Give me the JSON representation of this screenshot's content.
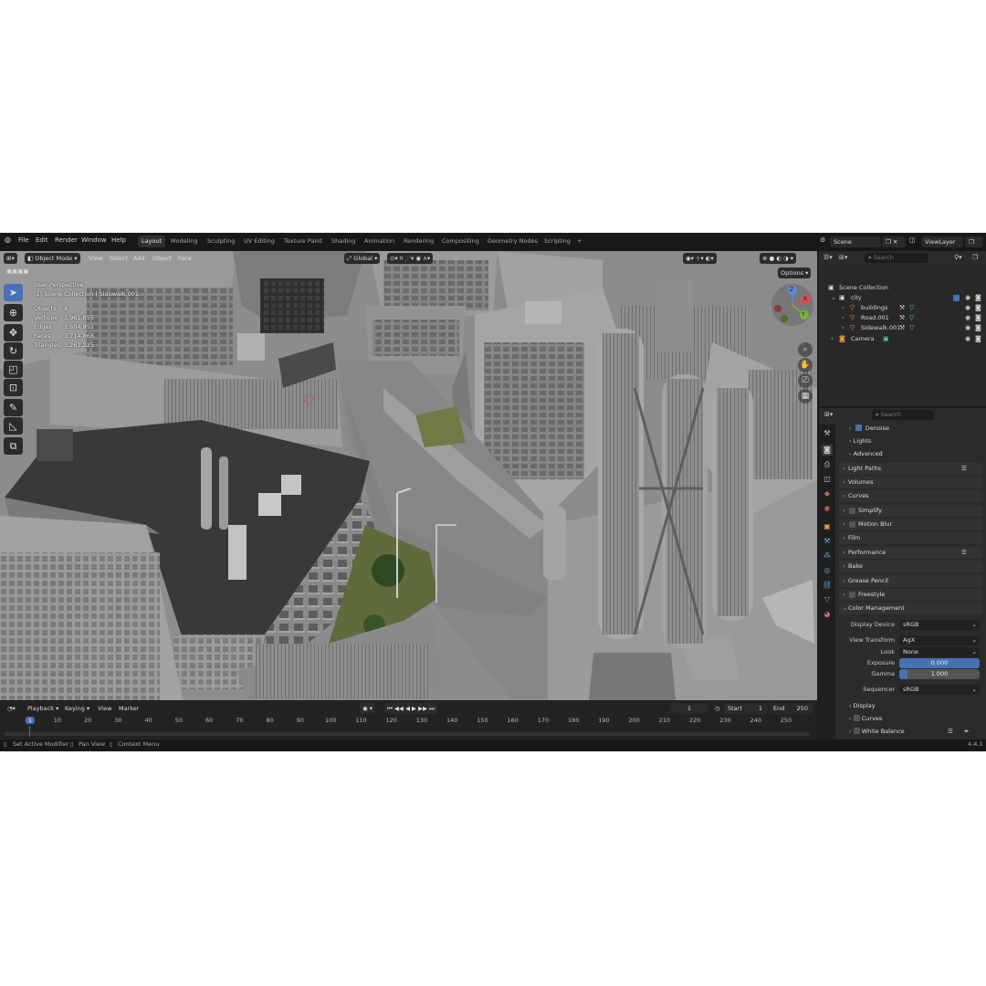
{
  "top_menu": {
    "logo": "blender-logo-icon",
    "items": [
      "File",
      "Edit",
      "Render",
      "Window",
      "Help"
    ],
    "workspaces": [
      "Layout",
      "Modeling",
      "Sculpting",
      "UV Editing",
      "Texture Paint",
      "Shading",
      "Animation",
      "Rendering",
      "Compositing",
      "Geometry Nodes",
      "Scripting"
    ],
    "active_workspace": "Layout",
    "add_tab": "+",
    "scene_name": "Scene",
    "view_layer": "ViewLayer"
  },
  "viewport_header": {
    "mode": "Object Mode",
    "menus": [
      "View",
      "Select",
      "Add",
      "Object",
      "Face"
    ],
    "orientation": "Global",
    "options": "Options"
  },
  "viewport_overlay": {
    "perspective": "User Perspective",
    "collection": "(1) Scene Collection | Sidewalk.001",
    "stats": [
      {
        "label": "Objects",
        "value": "4"
      },
      {
        "label": "Vertices",
        "value": "3,965,855"
      },
      {
        "label": "Edges",
        "value": "3,604,851"
      },
      {
        "label": "Faces",
        "value": "1,714,868"
      },
      {
        "label": "Triangles",
        "value": "3,262,225"
      }
    ],
    "gizmo": {
      "x": "X",
      "y": "Y",
      "z": "Z"
    }
  },
  "outliner": {
    "search_placeholder": "Search",
    "rows": [
      {
        "name": "Scene Collection",
        "icon": "collection-icon"
      },
      {
        "name": "city",
        "icon": "collection-icon"
      },
      {
        "name": "buildings",
        "icon": "mesh-icon"
      },
      {
        "name": "Road.001",
        "icon": "mesh-icon"
      },
      {
        "name": "Sidewalk.001",
        "icon": "mesh-icon"
      },
      {
        "name": "Camera",
        "icon": "camera-icon"
      }
    ]
  },
  "properties": {
    "search_placeholder": "Search",
    "denoise": "Denoise",
    "lights": "Lights",
    "advanced": "Advanced",
    "panels": [
      "Light Paths",
      "Volumes",
      "Curves",
      "Simplify",
      "Motion Blur",
      "Film",
      "Performance",
      "Bake",
      "Grease Pencil",
      "Freestyle",
      "Color Management"
    ],
    "color_management": {
      "display_device_label": "Display Device",
      "display_device": "sRGB",
      "view_transform_label": "View Transform",
      "view_transform": "AgX",
      "look_label": "Look",
      "look": "None",
      "exposure_label": "Exposure",
      "exposure": "0.000",
      "gamma_label": "Gamma",
      "gamma": "1.000",
      "gamma_fraction": 0.1,
      "sequencer_label": "Sequencer",
      "sequencer": "sRGB"
    },
    "sub_panels": [
      "Display",
      "Curves",
      "White Balance"
    ]
  },
  "timeline": {
    "menus": [
      "Playback",
      "Keying",
      "View",
      "Marker"
    ],
    "current_frame": "1",
    "start_label": "Start",
    "start": "1",
    "end_label": "End",
    "end": "250",
    "ruler": [
      "1",
      "10",
      "20",
      "30",
      "40",
      "50",
      "60",
      "70",
      "80",
      "90",
      "100",
      "110",
      "120",
      "130",
      "140",
      "150",
      "160",
      "170",
      "180",
      "190",
      "200",
      "210",
      "220",
      "230",
      "240",
      "250"
    ]
  },
  "status_bar": {
    "hints": [
      "Set Active Modifier",
      "Pan View",
      "Context Menu"
    ],
    "version": "4.4.1"
  }
}
